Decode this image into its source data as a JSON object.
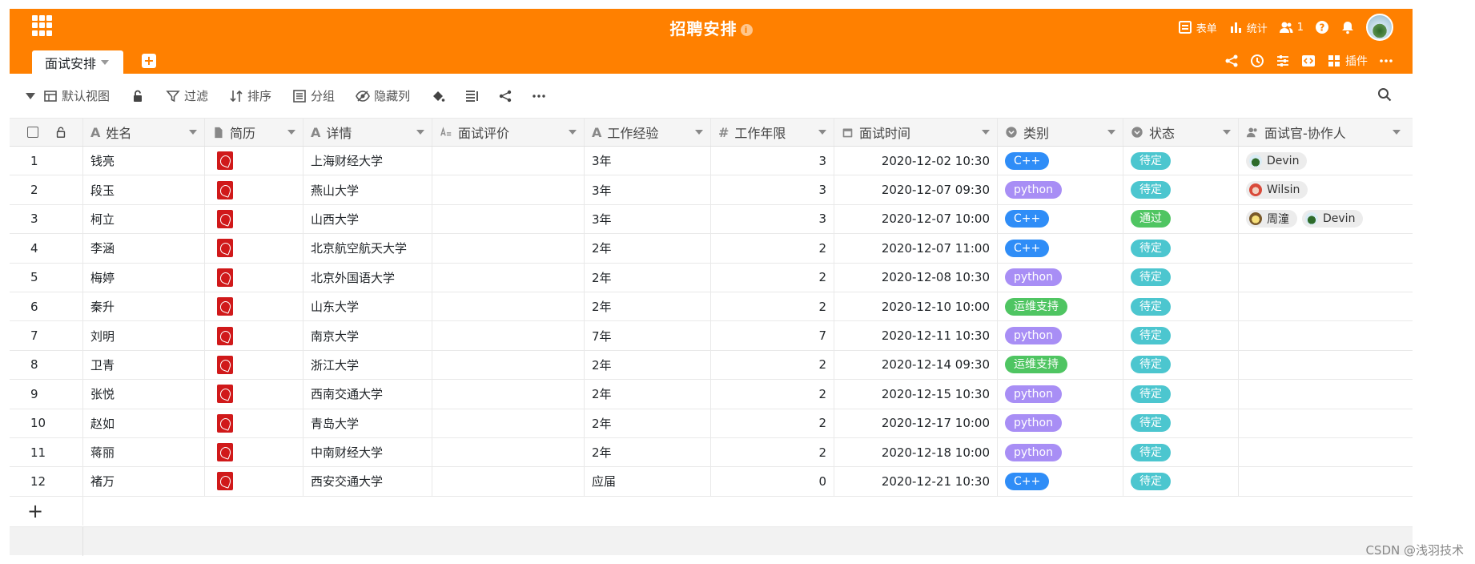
{
  "app": {
    "title": "招聘安排"
  },
  "topbar": {
    "form_label": "表单",
    "stats_label": "统计",
    "members_count": "1",
    "plugins_label": "插件"
  },
  "tabs": [
    {
      "label": "面试安排"
    }
  ],
  "toolbar": {
    "view_label": "默认视图",
    "filter_label": "过滤",
    "sort_label": "排序",
    "group_label": "分组",
    "hide_label": "隐藏列"
  },
  "columns": {
    "name": "姓名",
    "resume": "简历",
    "detail": "详情",
    "eval": "面试评价",
    "exp": "工作经验",
    "years": "工作年限",
    "time": "面试时间",
    "type": "类别",
    "status": "状态",
    "staff": "面试官-协作人"
  },
  "colors": {
    "header": "#ff8000",
    "cpp": "#2f8df7",
    "python": "#a88ef5",
    "ops": "#4fc562",
    "pending": "#4cc6cf",
    "passed": "#4fc562"
  },
  "rows": [
    {
      "idx": "1",
      "name": "钱亮",
      "detail": "上海财经大学",
      "eval": "",
      "exp": "3年",
      "years": "3",
      "time": "2020-12-02 10:30",
      "type": "C++",
      "status": "待定",
      "staff": [
        "Devin"
      ]
    },
    {
      "idx": "2",
      "name": "段玉",
      "detail": "燕山大学",
      "eval": "",
      "exp": "3年",
      "years": "3",
      "time": "2020-12-07 09:30",
      "type": "python",
      "status": "待定",
      "staff": [
        "Wilsin"
      ]
    },
    {
      "idx": "3",
      "name": "柯立",
      "detail": "山西大学",
      "eval": "",
      "exp": "3年",
      "years": "3",
      "time": "2020-12-07 10:00",
      "type": "C++",
      "status": "通过",
      "staff": [
        "周潼",
        "Devin"
      ]
    },
    {
      "idx": "4",
      "name": "李涵",
      "detail": "北京航空航天大学",
      "eval": "",
      "exp": "2年",
      "years": "2",
      "time": "2020-12-07 11:00",
      "type": "C++",
      "status": "待定",
      "staff": []
    },
    {
      "idx": "5",
      "name": "梅婷",
      "detail": "北京外国语大学",
      "eval": "",
      "exp": "2年",
      "years": "2",
      "time": "2020-12-08 10:30",
      "type": "python",
      "status": "待定",
      "staff": []
    },
    {
      "idx": "6",
      "name": "秦升",
      "detail": "山东大学",
      "eval": "",
      "exp": "2年",
      "years": "2",
      "time": "2020-12-10 10:00",
      "type": "运维支持",
      "status": "待定",
      "staff": []
    },
    {
      "idx": "7",
      "name": "刘明",
      "detail": "南京大学",
      "eval": "",
      "exp": "7年",
      "years": "7",
      "time": "2020-12-11 10:30",
      "type": "python",
      "status": "待定",
      "staff": []
    },
    {
      "idx": "8",
      "name": "卫青",
      "detail": "浙江大学",
      "eval": "",
      "exp": "2年",
      "years": "2",
      "time": "2020-12-14 09:30",
      "type": "运维支持",
      "status": "待定",
      "staff": []
    },
    {
      "idx": "9",
      "name": "张悦",
      "detail": "西南交通大学",
      "eval": "",
      "exp": "2年",
      "years": "2",
      "time": "2020-12-15 10:30",
      "type": "python",
      "status": "待定",
      "staff": []
    },
    {
      "idx": "10",
      "name": "赵如",
      "detail": "青岛大学",
      "eval": "",
      "exp": "2年",
      "years": "2",
      "time": "2020-12-17 10:00",
      "type": "python",
      "status": "待定",
      "staff": []
    },
    {
      "idx": "11",
      "name": "蒋丽",
      "detail": "中南财经大学",
      "eval": "",
      "exp": "2年",
      "years": "2",
      "time": "2020-12-18 10:00",
      "type": "python",
      "status": "待定",
      "staff": []
    },
    {
      "idx": "12",
      "name": "褚万",
      "detail": "西安交通大学",
      "eval": "",
      "exp": "应届",
      "years": "0",
      "time": "2020-12-21 10:30",
      "type": "C++",
      "status": "待定",
      "staff": []
    }
  ],
  "add_row_label": "+",
  "watermark": "CSDN @浅羽技术"
}
